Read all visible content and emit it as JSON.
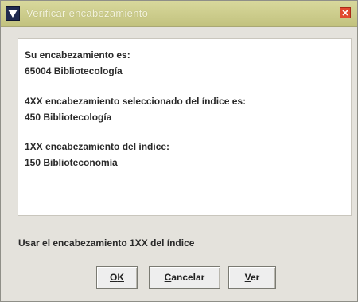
{
  "window": {
    "title": "Verificar encabezamiento",
    "close_icon": "close-icon",
    "app_icon": "app-logo-icon"
  },
  "content": {
    "heading_label": "Su encabezamiento es:",
    "heading_value": "65004 Bibliotecología",
    "selected_label": "4XX encabezamiento seleccionado del índice es:",
    "selected_value": "450  Bibliotecología",
    "index_label": "1XX encabezamiento del índice:",
    "index_value": "150  Biblioteconomía"
  },
  "usage_text": "Usar el encabezamiento 1XX del índice",
  "buttons": {
    "ok": {
      "mnemonic": "O",
      "rest": "K"
    },
    "cancel": {
      "mnemonic": "C",
      "rest": "ancelar"
    },
    "view": {
      "mnemonic": "V",
      "rest": "er"
    }
  },
  "colors": {
    "titlebar": "#c2c27e",
    "close": "#e14a2e",
    "panel": "#ffffff"
  }
}
